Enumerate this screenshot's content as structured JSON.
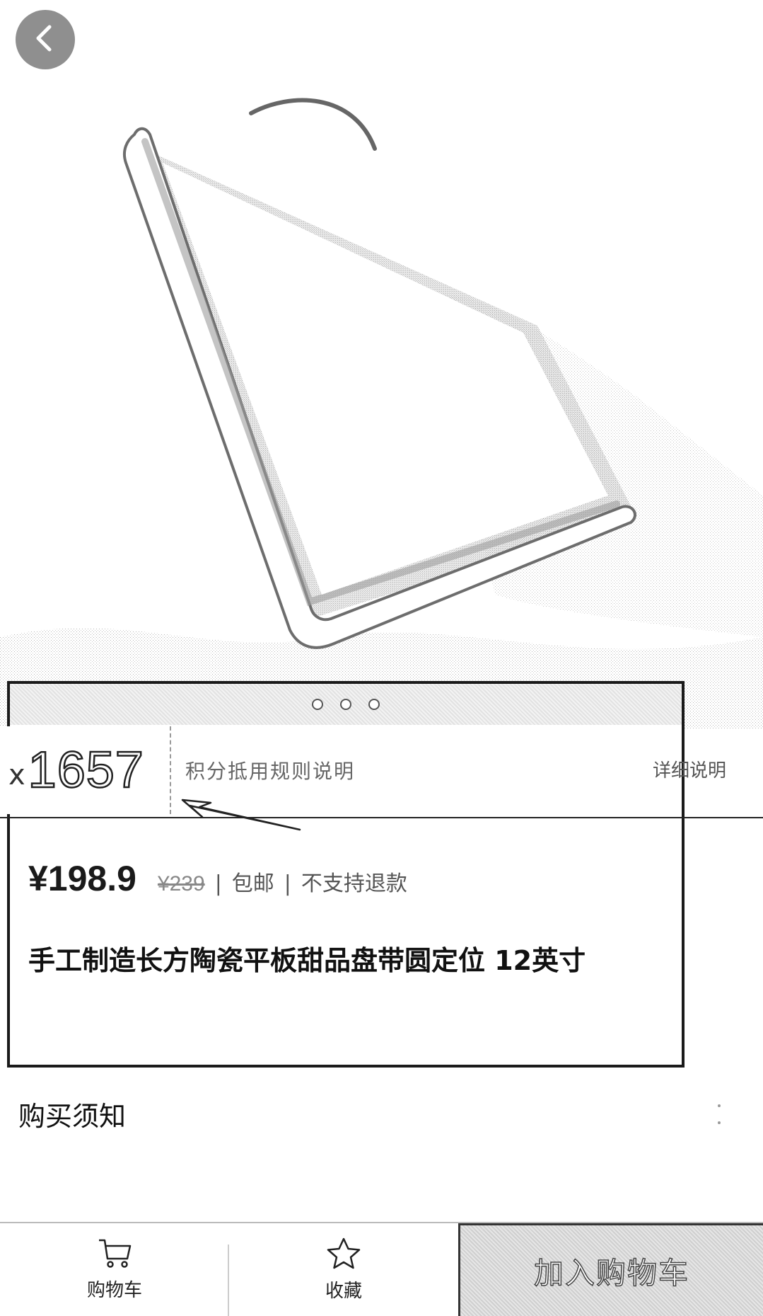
{
  "header": {
    "back_icon": "chevron-left-icon"
  },
  "carousel": {
    "total": 3,
    "active": 1
  },
  "points": {
    "prefix": "x",
    "value": "1657",
    "text": "积分抵用规则说明",
    "link": "详细说明"
  },
  "product": {
    "price": "¥198.9",
    "original_price": "¥239",
    "sep1": "|",
    "tag1": "包邮",
    "sep2": "|",
    "tag2": "不支持退款",
    "title": "手工制造长方陶瓷平板甜品盘带圆定位 12英寸"
  },
  "notice": {
    "label": "购买须知",
    "arrow_icon": "chevron-right-icon"
  },
  "bottom_bar": {
    "cart_label": "购物车",
    "cart_icon": "cart-icon",
    "favorite_label": "收藏",
    "favorite_icon": "star-icon",
    "add_cart_label": "加入购物车"
  }
}
